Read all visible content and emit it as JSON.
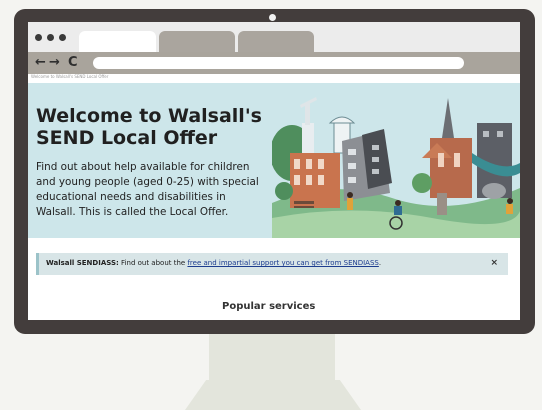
{
  "browser": {
    "nav_back": "←",
    "nav_forward": "→",
    "nav_reload": "C",
    "breadcrumb": "Welcome to Walsall's SEND Local Offer"
  },
  "hero": {
    "title_line1": "Welcome to Walsall's",
    "title_line2": "SEND Local Offer",
    "description": "Find out about help available for children and young people (aged 0-25) with special educational needs and disabilities in Walsall. This is called the Local Offer."
  },
  "notice": {
    "label": "Walsall SENDIASS:",
    "text": "Find out about the",
    "link": "free and impartial support you can get from SENDIASS",
    "after": ".",
    "close": "×"
  },
  "section": {
    "heading": "Popular services"
  },
  "colors": {
    "bezel": "#433d3c",
    "hero_bg": "#cde6ea",
    "notice_bg": "#d8e5e7",
    "link": "#1d3d8f"
  }
}
